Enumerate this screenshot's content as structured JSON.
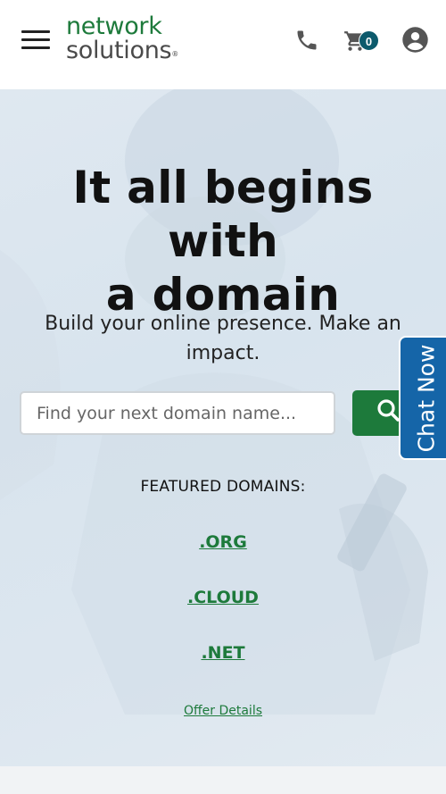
{
  "header": {
    "logo": {
      "line1": "network",
      "line2": "solutions",
      "reg": "®"
    },
    "cart_count": "0",
    "colors": {
      "brand_green": "#1d7a3b",
      "badge": "#0c5a6c"
    },
    "icons": [
      "hamburger-menu-icon",
      "phone-icon",
      "cart-icon",
      "account-icon"
    ]
  },
  "hero": {
    "headline_line1": "It all begins with",
    "headline_line2": "a domain",
    "subhead": "Build your online presence. Make an impact.",
    "search": {
      "placeholder": "Find your next domain name...",
      "value": ""
    },
    "featured_label": "FEATURED DOMAINS:",
    "featured_domains": [
      ".ORG",
      ".CLOUD",
      ".NET"
    ],
    "offer_details": "Offer Details"
  },
  "chat": {
    "label": "Chat Now",
    "color": "#1565a8"
  }
}
